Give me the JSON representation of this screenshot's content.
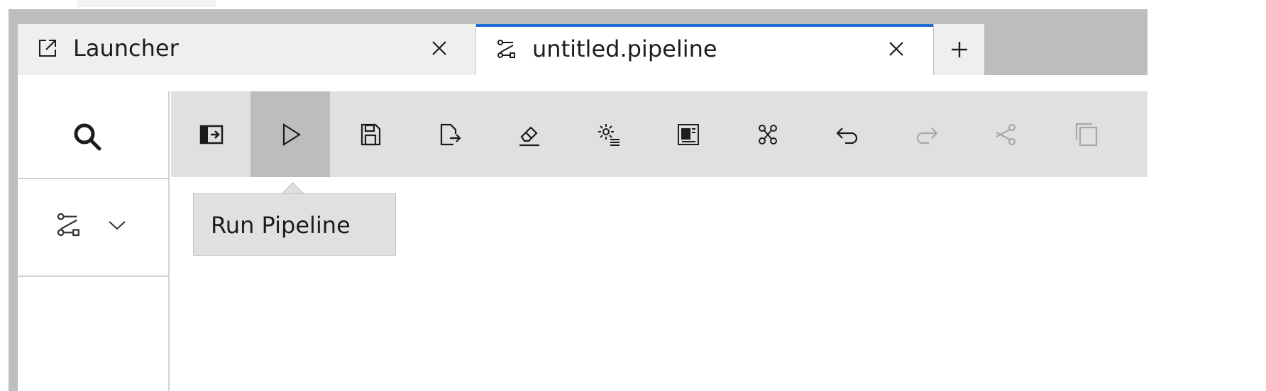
{
  "tabs": {
    "launcher": {
      "label": "Launcher",
      "icon": "launch-icon"
    },
    "pipeline": {
      "label": "untitled.pipeline",
      "icon": "pipeline-icon",
      "active": true
    },
    "add_icon": "plus-icon"
  },
  "sidebar": {
    "search_icon": "search-icon",
    "palette_icon": "pipeline-icon",
    "palette_chevron": "chevron-down-icon"
  },
  "toolbar": {
    "buttons": [
      {
        "id": "open-panel",
        "icon": "open-panel-icon",
        "state": "enabled"
      },
      {
        "id": "run-pipeline",
        "icon": "play-icon",
        "state": "hovered"
      },
      {
        "id": "save",
        "icon": "save-icon",
        "state": "enabled"
      },
      {
        "id": "export",
        "icon": "export-icon",
        "state": "enabled"
      },
      {
        "id": "clear",
        "icon": "eraser-icon",
        "state": "enabled"
      },
      {
        "id": "runtimes",
        "icon": "settings-list-icon",
        "state": "enabled"
      },
      {
        "id": "runtime-images",
        "icon": "container-icon",
        "state": "enabled"
      },
      {
        "id": "components",
        "icon": "components-icon",
        "state": "enabled"
      },
      {
        "id": "undo",
        "icon": "undo-icon",
        "state": "enabled"
      },
      {
        "id": "redo",
        "icon": "redo-icon",
        "state": "disabled"
      },
      {
        "id": "cut",
        "icon": "scissors-icon",
        "state": "disabled"
      },
      {
        "id": "copy",
        "icon": "copy-icon",
        "state": "disabled"
      }
    ]
  },
  "tooltip": {
    "text": "Run Pipeline"
  },
  "colors": {
    "accent": "#1d6fd6",
    "toolbar_bg": "#e0e0e0",
    "hover_bg": "#bdbdbd",
    "disabled_icon": "#a8a8a8",
    "icon": "#1c1c1c"
  }
}
